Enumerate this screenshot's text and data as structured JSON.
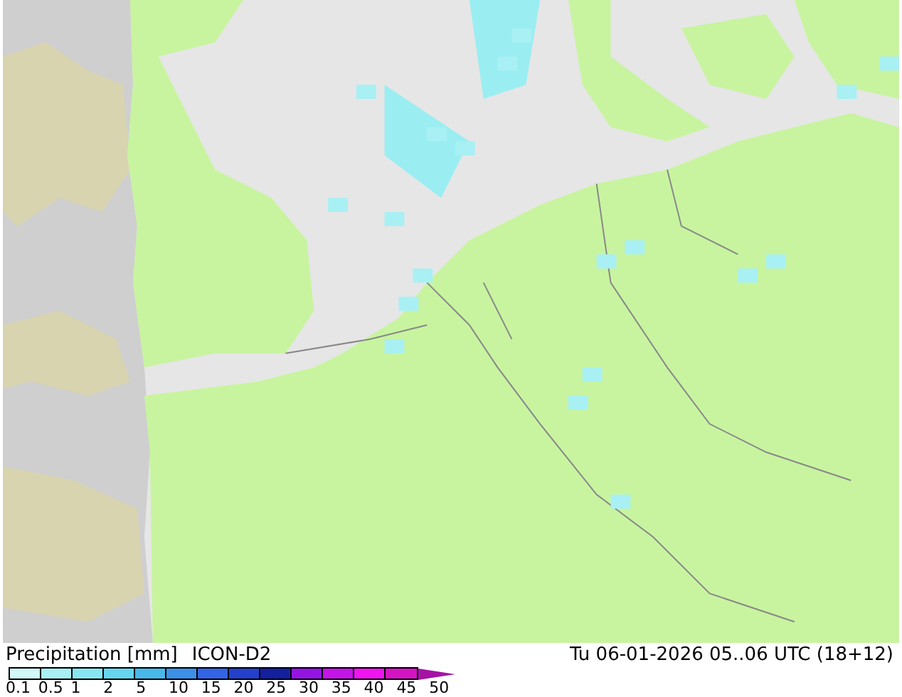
{
  "legend": {
    "title": "Precipitation [mm]",
    "model": "ICON-D2",
    "valid_time": "Tu 06-01-2026 05..06 UTC (18+12)",
    "segments": [
      {
        "color": "#d2f8f8"
      },
      {
        "color": "#a8f0f4"
      },
      {
        "color": "#88e6f0"
      },
      {
        "color": "#64d6ee"
      },
      {
        "color": "#48b8ea"
      },
      {
        "color": "#3c90e8"
      },
      {
        "color": "#3464e6"
      },
      {
        "color": "#2440cc"
      },
      {
        "color": "#1420a0"
      },
      {
        "color": "#9414e4"
      },
      {
        "color": "#c414e8"
      },
      {
        "color": "#f014f0"
      },
      {
        "color": "#d414c4"
      },
      {
        "kind": "arrow",
        "color": "#a414a4"
      }
    ],
    "labels": [
      "0.1",
      "0.5",
      "1",
      "2",
      "5",
      "10",
      "15",
      "20",
      "25",
      "30",
      "35",
      "40",
      "45",
      "50"
    ]
  }
}
